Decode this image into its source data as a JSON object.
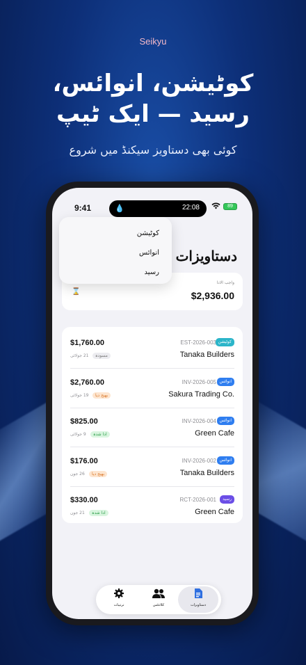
{
  "brand": "Seikyu",
  "headline_1": "کوٹیشن، انوائس،",
  "headline_2": "رسید — ایک ٹیپ",
  "subhead": "کوئی بھی دستاویز سیکنڈ میں شروع",
  "status_bar": {
    "time": "9:41",
    "island_time": "22:08",
    "battery": "89"
  },
  "dropdown": {
    "items": [
      "کوٹیشن",
      "انوائس",
      "رسید"
    ]
  },
  "page_title": "دستاویزات",
  "summary": {
    "label": "واجب الادا",
    "value": "$2,936.00"
  },
  "documents": [
    {
      "amount": "$1,760.00",
      "doc_no": "EST-2026-003",
      "type": "کوٹیشن",
      "type_color": "#2bb5c9",
      "client": "Tanaka Builders",
      "date": "21 جولائی",
      "status": "مسودہ",
      "status_bg": "#ececf0",
      "status_fg": "#777"
    },
    {
      "amount": "$2,760.00",
      "doc_no": "INV-2026-005",
      "type": "انوائس",
      "type_color": "#2f7ef0",
      "client": "Sakura Trading Co.",
      "date": "19 جولائی",
      "status": "بھیج دیا",
      "status_bg": "#fde5cf",
      "status_fg": "#d9772a"
    },
    {
      "amount": "$825.00",
      "doc_no": "INV-2026-004",
      "type": "انوائس",
      "type_color": "#2f7ef0",
      "client": "Green Cafe",
      "date": "9 جولائی",
      "status": "ادا شدہ",
      "status_bg": "#d9f5df",
      "status_fg": "#2e9e4a"
    },
    {
      "amount": "$176.00",
      "doc_no": "INV-2026-002",
      "type": "انوائس",
      "type_color": "#2f7ef0",
      "client": "Tanaka Builders",
      "date": "26 جون",
      "status": "بھیج دیا",
      "status_bg": "#fde5cf",
      "status_fg": "#d9772a"
    },
    {
      "amount": "$330.00",
      "doc_no": "RCT-2026-001",
      "type": "رسید",
      "type_color": "#6b4ee6",
      "client": "Green Cafe",
      "date": "21 جون",
      "status": "ادا شدہ",
      "status_bg": "#d9f5df",
      "status_fg": "#2e9e4a"
    }
  ],
  "tabs": [
    {
      "icon": "settings-icon",
      "label": "ترتیبات"
    },
    {
      "icon": "clients-icon",
      "label": "کلائنٹس"
    },
    {
      "icon": "documents-icon",
      "label": "دستاویزات"
    }
  ]
}
